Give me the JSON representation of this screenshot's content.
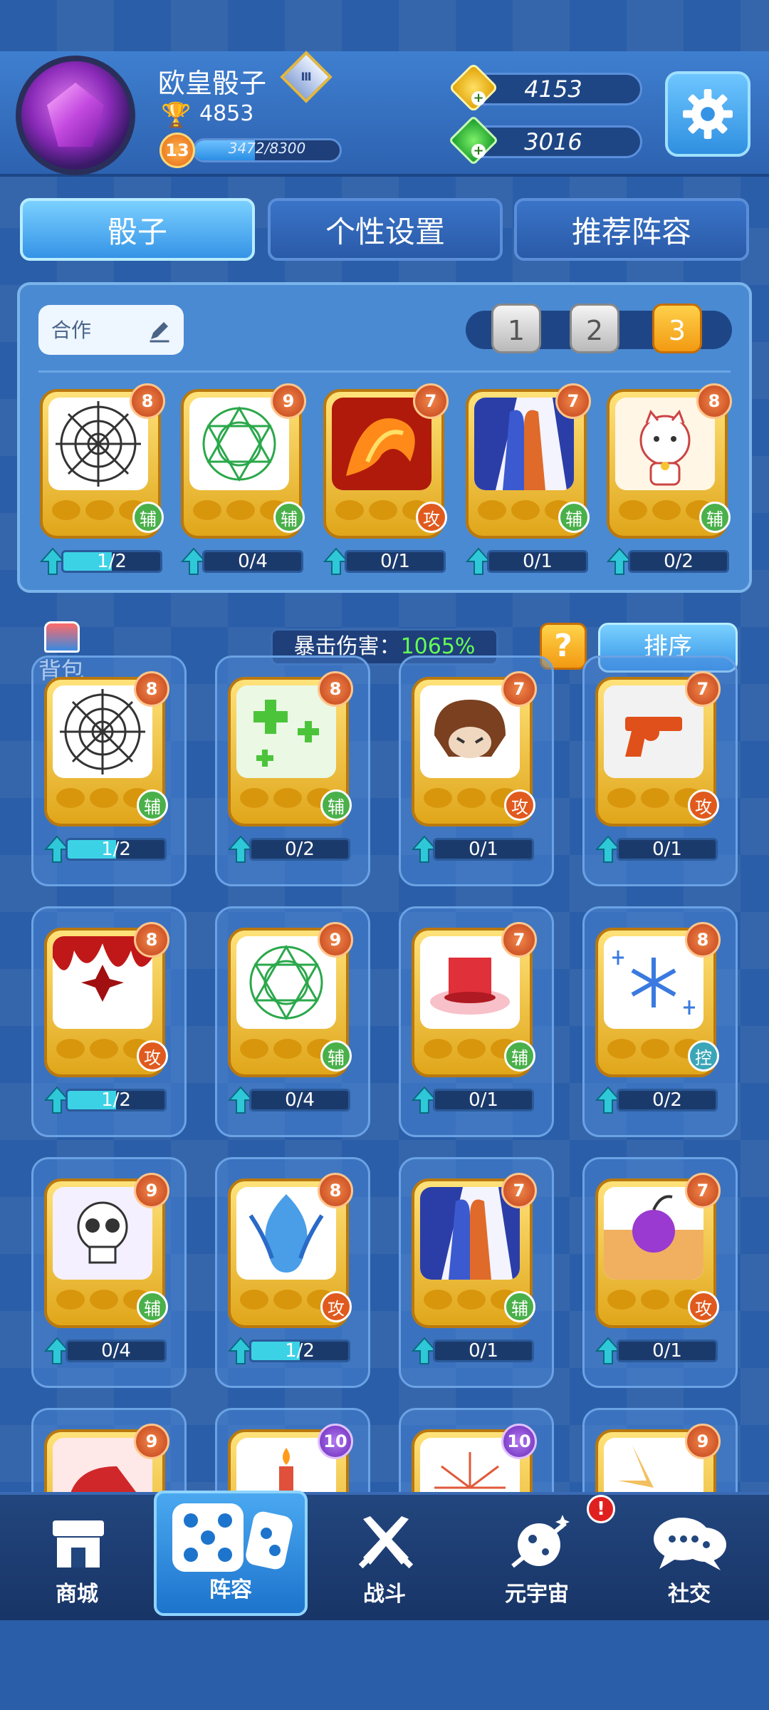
{
  "header": {
    "username": "欧皇骰子",
    "rank_badge": "Ⅲ",
    "trophies": "4853",
    "level": "13",
    "xp_text": "3472/8300",
    "xp_fraction": 0.418,
    "gold": "4153",
    "gems": "3016"
  },
  "tabs": [
    {
      "label": "骰子",
      "active": true
    },
    {
      "label": "个性设置",
      "active": false
    },
    {
      "label": "推荐阵容",
      "active": false
    }
  ],
  "deck": {
    "name": "合作",
    "presets": [
      "1",
      "2",
      "3"
    ],
    "active_preset": "3",
    "cards": [
      {
        "icon": "spider-web-icon",
        "level": "8",
        "type": "辅",
        "count": "1/2",
        "progress": 0.5
      },
      {
        "icon": "magic-circle-icon",
        "level": "9",
        "type": "辅",
        "count": "0/4",
        "progress": 0
      },
      {
        "icon": "fire-dragon-icon",
        "level": "7",
        "type": "攻",
        "count": "0/1",
        "progress": 0
      },
      {
        "icon": "mirror-figure-icon",
        "level": "7",
        "type": "辅",
        "count": "0/1",
        "progress": 0
      },
      {
        "icon": "lucky-cat-icon",
        "level": "8",
        "type": "辅",
        "count": "0/2",
        "progress": 0
      }
    ]
  },
  "toolbar": {
    "bag_label": "背包",
    "crit_label": "暴击伤害：",
    "crit_value": "1065%",
    "help_label": "?",
    "sort_label": "排序"
  },
  "inventory": [
    {
      "icon": "spider-web-icon",
      "level": "8",
      "type": "辅",
      "count": "1/2",
      "progress": 0.5
    },
    {
      "icon": "heal-cross-icon",
      "level": "8",
      "type": "辅",
      "count": "0/2",
      "progress": 0
    },
    {
      "icon": "monster-face-icon",
      "level": "7",
      "type": "攻",
      "count": "0/1",
      "progress": 0
    },
    {
      "icon": "revolver-icon",
      "level": "7",
      "type": "攻",
      "count": "0/1",
      "progress": 0
    },
    {
      "icon": "shuriken-icon",
      "level": "8",
      "type": "攻",
      "count": "1/2",
      "progress": 0.5
    },
    {
      "icon": "magic-circle-icon",
      "level": "9",
      "type": "辅",
      "count": "0/4",
      "progress": 0
    },
    {
      "icon": "red-top-hat-icon",
      "level": "7",
      "type": "辅",
      "count": "0/1",
      "progress": 0
    },
    {
      "icon": "snowflake-icon",
      "level": "8",
      "type": "控",
      "count": "0/2",
      "progress": 0
    },
    {
      "icon": "skull-icon",
      "level": "9",
      "type": "辅",
      "count": "0/4",
      "progress": 0
    },
    {
      "icon": "blue-flame-icon",
      "level": "8",
      "type": "攻",
      "count": "1/2",
      "progress": 0.5
    },
    {
      "icon": "mirror-figure-icon",
      "level": "7",
      "type": "辅",
      "count": "0/1",
      "progress": 0
    },
    {
      "icon": "purple-bomb-icon",
      "level": "7",
      "type": "攻",
      "count": "0/1",
      "progress": 0
    },
    {
      "icon": "meat-icon",
      "level": "9"
    },
    {
      "icon": "candle-icon",
      "level": "10"
    },
    {
      "icon": "firework-icon",
      "level": "10"
    },
    {
      "icon": "light-burst-icon",
      "level": "9"
    }
  ],
  "nav": [
    {
      "label": "商城",
      "icon": "shop-icon"
    },
    {
      "label": "阵容",
      "icon": "dice-icon",
      "active": true
    },
    {
      "label": "战斗",
      "icon": "crossed-swords-icon"
    },
    {
      "label": "元宇宙",
      "icon": "planet-icon",
      "badge": "!"
    },
    {
      "label": "社交",
      "icon": "chat-icon"
    }
  ],
  "colors": {
    "background": "#2a5ea8",
    "accent_blue": "#3593e6",
    "gold": "#f29a12",
    "crit_green": "#66ff55"
  }
}
